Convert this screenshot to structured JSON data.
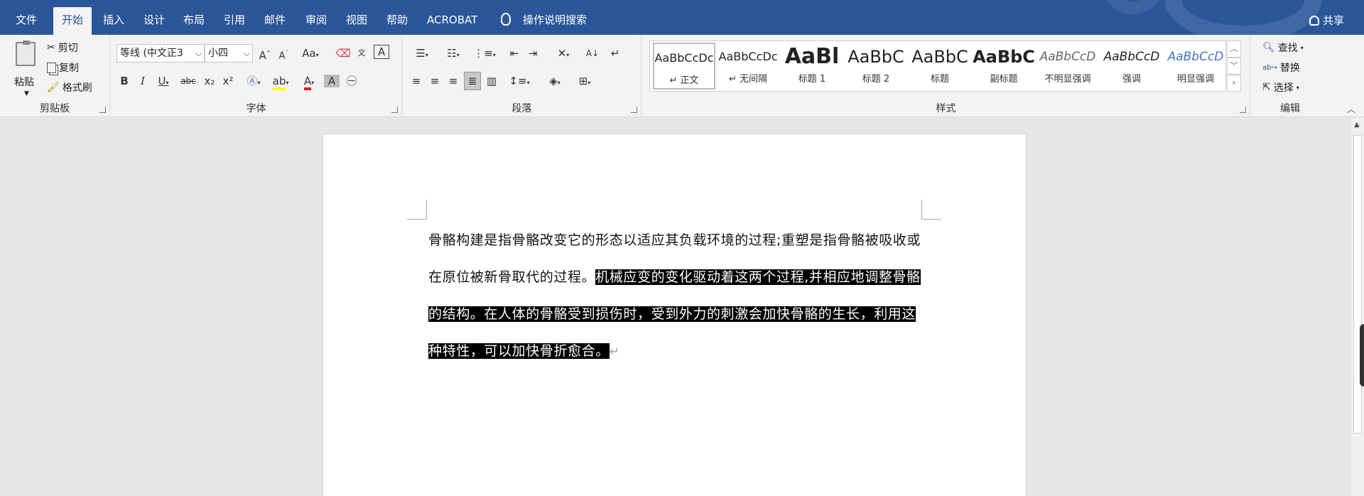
{
  "tabs": [
    "文件",
    "开始",
    "插入",
    "设计",
    "布局",
    "引用",
    "邮件",
    "审阅",
    "视图",
    "帮助",
    "ACROBAT"
  ],
  "active_tab": "开始",
  "tell_me": "操作说明搜索",
  "share": "共享",
  "clipboard": {
    "paste": "粘贴",
    "cut": "剪切",
    "copy": "复制",
    "format_painter": "格式刷",
    "label": "剪贴板"
  },
  "font": {
    "name": "等线 (中文正3",
    "size": "小四",
    "label": "字体",
    "bold": "B",
    "italic": "I",
    "underline": "U",
    "strike": "abc",
    "sub": "x₂",
    "sup": "x²",
    "grow": "A",
    "shrink": "A",
    "case": "Aa",
    "char_border": "A"
  },
  "paragraph": {
    "label": "段落"
  },
  "styles": {
    "label": "样式",
    "items": [
      {
        "sample": "AaBbCcDc",
        "name": "↵ 正文"
      },
      {
        "sample": "AaBbCcDc",
        "name": "↵ 无间隔"
      },
      {
        "sample": "AaBl",
        "name": "标题 1"
      },
      {
        "sample": "AaBbC",
        "name": "标题 2"
      },
      {
        "sample": "AaBbC",
        "name": "标题"
      },
      {
        "sample": "AaBbC",
        "name": "副标题"
      },
      {
        "sample": "AaBbCcD",
        "name": "不明显强调"
      },
      {
        "sample": "AaBbCcD",
        "name": "强调"
      },
      {
        "sample": "AaBbCcD",
        "name": "明显强调"
      }
    ]
  },
  "editing": {
    "find": "查找",
    "replace": "替换",
    "select": "选择",
    "label": "编辑"
  },
  "document": {
    "normal_text": "骨骼构建是指骨骼改变它的形态以适应其负载环境的过程;重塑是指骨骼被吸收或在原位被新骨取代的过程。",
    "highlighted_text": "机械应变的变化驱动着这两个过程,并相应地调整骨骼的结构。在人体的骨骼受到损伤时，受到外力的刺激会加快骨骼的生长，利用这种特性，可以加快骨折愈合。",
    "para_mark": "↵"
  },
  "colors": {
    "titlebar": "#2b579a",
    "ribbon": "#f3f3f3",
    "highlight_bg": "#000000",
    "font_color": "#e81123",
    "highlight_color": "#ffff00"
  }
}
